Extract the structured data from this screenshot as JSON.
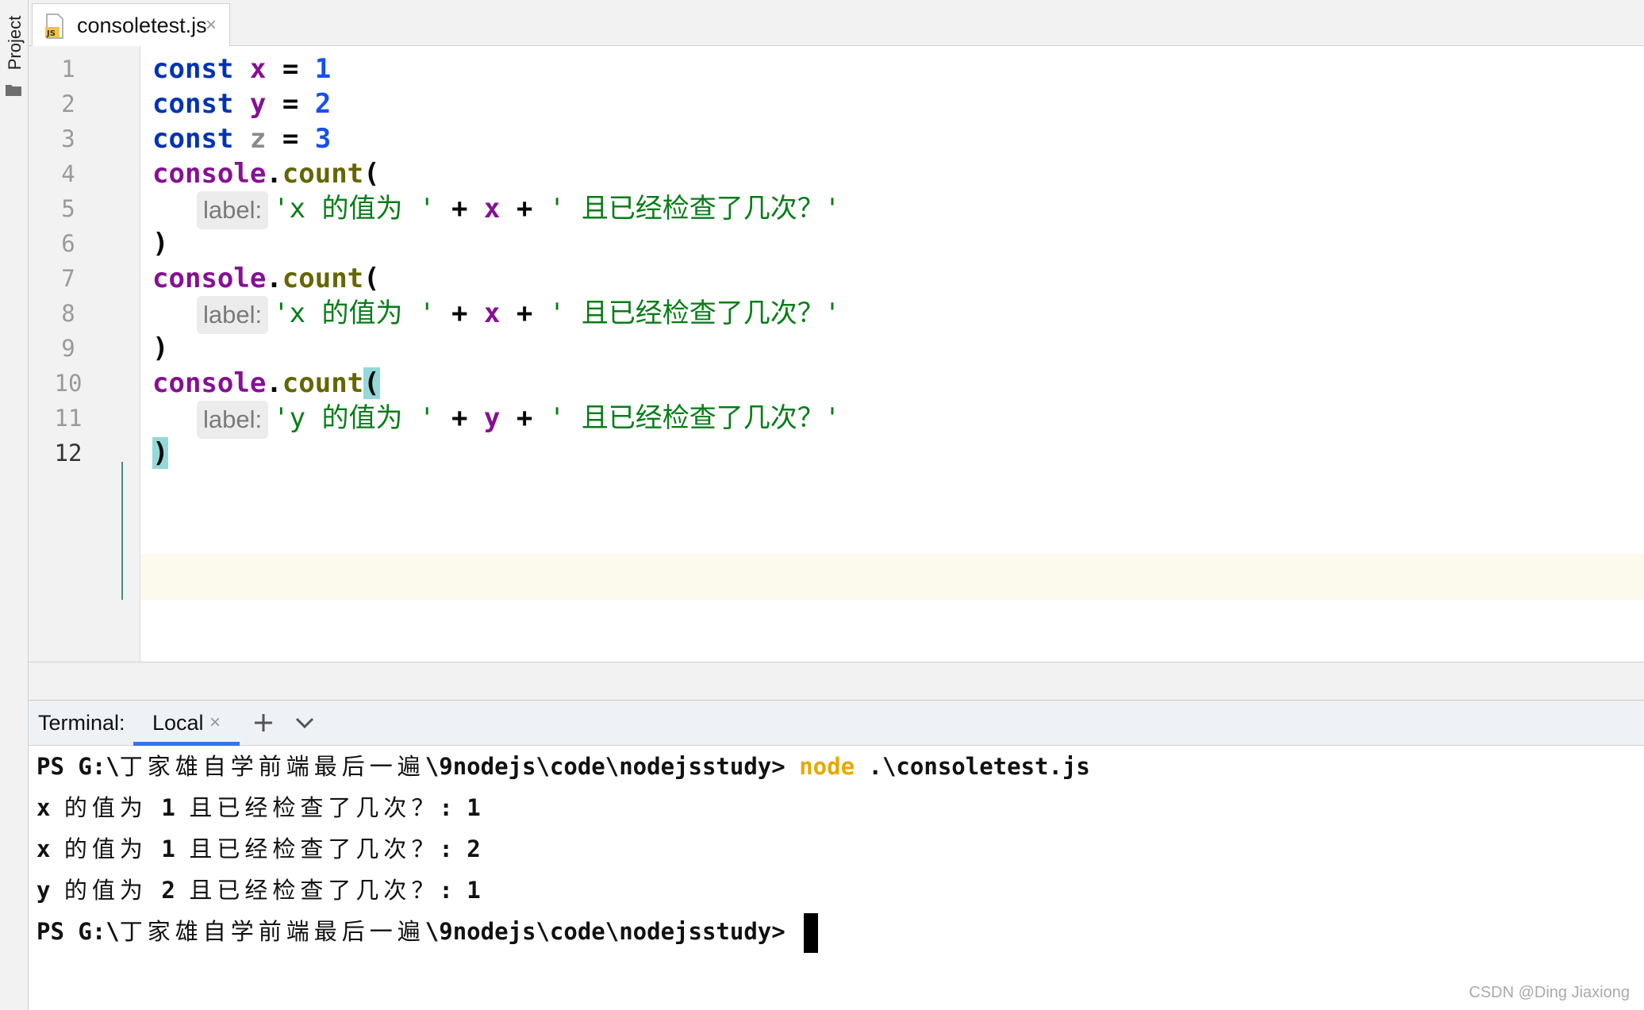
{
  "sidebar": {
    "project_label": "Project"
  },
  "tab": {
    "filename": "consoletest.js",
    "close": "×",
    "icon_label": "JS"
  },
  "editor": {
    "line_numbers": [
      "1",
      "2",
      "3",
      "4",
      "5",
      "6",
      "7",
      "8",
      "9",
      "10",
      "11",
      "12"
    ],
    "lines": [
      {
        "kw": "const",
        "id": "x",
        "op": "=",
        "num": "1"
      },
      {
        "kw": "const",
        "id": "y",
        "op": "=",
        "num": "2"
      },
      {
        "kw": "const",
        "id": "z",
        "op": "=",
        "num": "3"
      },
      {
        "obj": "console",
        "dot": ".",
        "fn": "count",
        "paren": "("
      },
      {
        "hint": "label:",
        "s1": "'x 的值为 '",
        "plus1": "+",
        "var": "x",
        "plus2": "+",
        "s2": "' 且已经检查了几次？'"
      },
      {
        "close": ")"
      },
      {
        "obj": "console",
        "dot": ".",
        "fn": "count",
        "paren": "("
      },
      {
        "hint": "label:",
        "s1": "'x 的值为 '",
        "plus1": "+",
        "var": "x",
        "plus2": "+",
        "s2": "' 且已经检查了几次？'"
      },
      {
        "close": ")"
      },
      {
        "obj": "console",
        "dot": ".",
        "fn": "count",
        "paren": "("
      },
      {
        "hint": "label:",
        "s1": "'y 的值为 '",
        "plus1": "+",
        "var": "y",
        "plus2": "+",
        "s2": "' 且已经检查了几次？'"
      },
      {
        "close": ")"
      }
    ]
  },
  "terminal": {
    "title": "Terminal:",
    "tab_label": "Local",
    "tab_close": "×",
    "lines": [
      {
        "prefix": "PS G:\\",
        "cjk": "丁家雄自学前端最后一遍",
        "suffix": "\\9nodejs\\code\\nodejsstudy>",
        "cmd": "node",
        "args": ".\\consoletest.js"
      },
      {
        "a": "x ",
        "cjk1": "的值为",
        "b": " 1 ",
        "cjk2": "且已经检查了几次？",
        "c": ": 1"
      },
      {
        "a": "x ",
        "cjk1": "的值为",
        "b": " 1 ",
        "cjk2": "且已经检查了几次？",
        "c": ": 2"
      },
      {
        "a": "y ",
        "cjk1": "的值为",
        "b": " 2 ",
        "cjk2": "且已经检查了几次？",
        "c": ": 1"
      },
      {
        "prefix": "PS G:\\",
        "cjk": "丁家雄自学前端最后一遍",
        "suffix": "\\9nodejs\\code\\nodejsstudy>"
      }
    ]
  },
  "watermark": "CSDN @Ding Jiaxiong",
  "colors": {
    "keyword": "#0033b3",
    "identifier": "#871094",
    "number": "#1750eb",
    "string": "#067d17",
    "accent": "#3574f0",
    "node_cmd": "#e8a800"
  }
}
